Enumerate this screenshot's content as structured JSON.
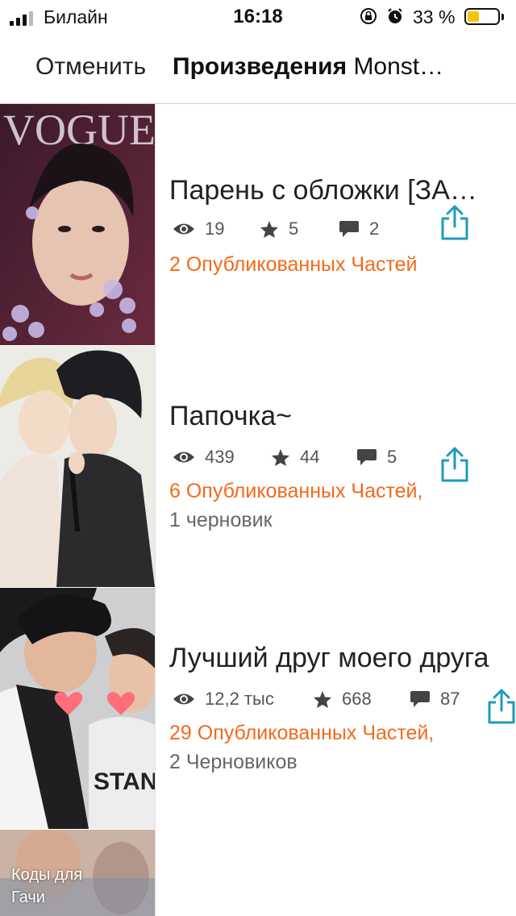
{
  "status_bar": {
    "carrier": "Билайн",
    "time": "16:18",
    "battery_percent": "33 %",
    "battery_level": 0.33
  },
  "header": {
    "cancel_label": "Отменить",
    "title_bold": "Произведения",
    "title_rest": "Monst…"
  },
  "stories": [
    {
      "title": "Парень с обложки [ЗА…",
      "views": "19",
      "votes": "5",
      "comments": "2",
      "published": "2 Опубликованных Частей",
      "drafts": ""
    },
    {
      "title": "Папочка~",
      "views": "439",
      "votes": "44",
      "comments": "5",
      "published": "6 Опубликованных Частей,",
      "drafts": "1 черновик"
    },
    {
      "title": "Лучший друг моего друга",
      "views": "12,2 тыс",
      "votes": "668",
      "comments": "87",
      "published": "29 Опубликованных Частей,",
      "drafts": "2 Черновиков"
    }
  ],
  "partial_cover_label": "Коды для Гачи",
  "colors": {
    "accent": "#f26a1b",
    "share": "#1e9bbf",
    "muted": "#666666"
  }
}
